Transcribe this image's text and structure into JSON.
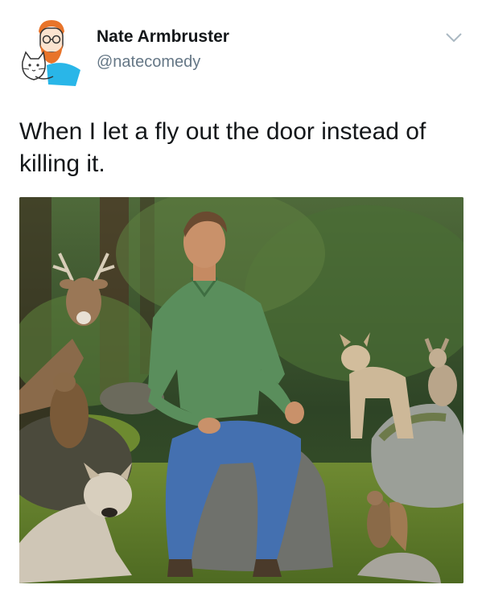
{
  "tweet": {
    "author_name": "Nate Armbruster",
    "author_handle": "@natecomedy",
    "text": "When I let a fly out the door instead of killing it."
  },
  "icons": {
    "avatar": "cartoon-avatar-with-cat",
    "menu": "chevron-down-icon"
  },
  "photo": {
    "subject": "man in green shirt sitting on a rock in a forest surrounded by animals",
    "animals": [
      "deer",
      "marmot",
      "coyote",
      "coyote",
      "rabbit",
      "squirrel"
    ]
  },
  "colors": {
    "name": "#14171a",
    "handle": "#657786",
    "chevron": "#aab8c2",
    "avatar_accent": "#29b6e8",
    "avatar_beard": "#e8742a"
  }
}
